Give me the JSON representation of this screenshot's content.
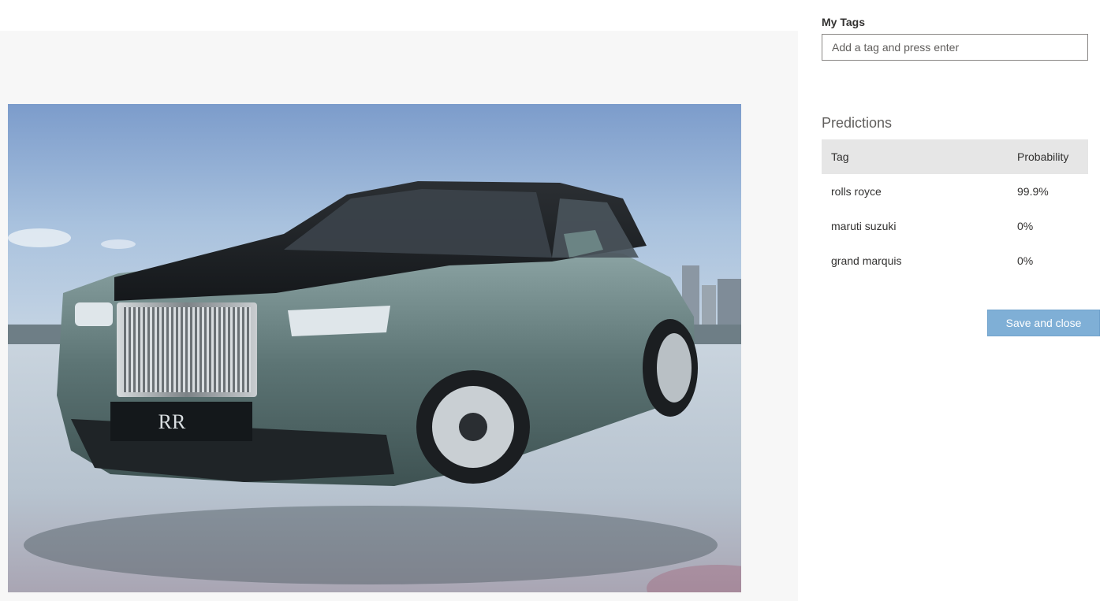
{
  "image": {
    "alt": "car photo"
  },
  "my_tags": {
    "label": "My Tags",
    "placeholder": "Add a tag and press enter",
    "value": ""
  },
  "predictions": {
    "title": "Predictions",
    "columns": [
      "Tag",
      "Probability"
    ],
    "rows": [
      {
        "tag": "rolls royce",
        "probability": "99.9%"
      },
      {
        "tag": "maruti suzuki",
        "probability": "0%"
      },
      {
        "tag": "grand marquis",
        "probability": "0%"
      }
    ]
  },
  "actions": {
    "save_label": "Save and close"
  },
  "colors": {
    "primary_button": "#7fafd6",
    "header_row": "#e6e6e6",
    "pane_background": "#f7f7f7"
  }
}
